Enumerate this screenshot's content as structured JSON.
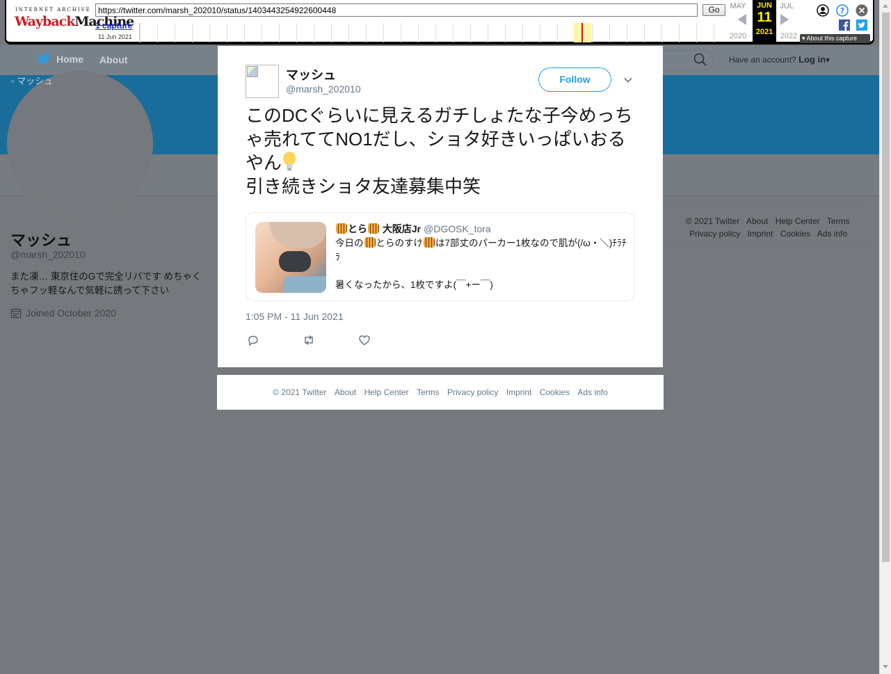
{
  "wayback": {
    "ia_label": "INTERNET ARCHIVE",
    "logo_part1": "Wayback",
    "logo_part2": "Machine",
    "url": "https://twitter.com/marsh_202010/status/1403443254922600448",
    "go_label": "Go",
    "capture_count": "1 capture",
    "capture_date": "11 Jun 2021",
    "prev_month": "MAY",
    "prev_year": "2020",
    "cur_month": "JUN",
    "cur_day": "11",
    "cur_year": "2021",
    "next_month": "JUL",
    "next_year": "2022",
    "about_capture": "▾ About this capture"
  },
  "nav": {
    "home_label": "Home",
    "about_label": "About",
    "login_prefix": "Have an account?",
    "login_label": "Log in"
  },
  "profile": {
    "avatar_alt": "マッシュ",
    "name": "マッシュ",
    "handle": "@marsh_202010",
    "bio": "また凍… 東京住のGで完全リバです めちゃくちゃフッ軽なんで気軽に誘って下さい",
    "joined": "Joined October 2020"
  },
  "side_footer": {
    "row1": [
      "© 2021 Twitter",
      "About",
      "Help Center",
      "Terms"
    ],
    "row2": [
      "Privacy policy",
      "Imprint",
      "Cookies",
      "Ads info"
    ]
  },
  "tweet": {
    "name": "マッシュ",
    "handle": "@marsh_202010",
    "follow_label": "Follow",
    "text_line1": "このDCぐらいに見えるガチしょたな子今めっちゃ売れててNO1だし、ショタ好きいっぱいおるやん",
    "text_line2": "引き続きショタ友達募集中笑",
    "timestamp": "1:05 PM - 11 Jun 2021",
    "quote": {
      "name_a": "とら",
      "name_b": "大阪店Jr",
      "handle": "@DGOSK_tora",
      "body_a": "今日の",
      "body_b": "とらのすけ",
      "body_c": "は7部丈のパーカー1枚なので肌が(/ω・＼)ﾁﾗﾁﾗ",
      "body_d": "暑くなったから、1枚ですよ(￣+ー￣)"
    }
  },
  "footer": {
    "links": [
      "© 2021 Twitter",
      "About",
      "Help Center",
      "Terms",
      "Privacy policy",
      "Imprint",
      "Cookies",
      "Ads info"
    ]
  },
  "colors": {
    "twitter_blue": "#1da1f2",
    "overlay_gray": "#75797d",
    "banner_blue": "#1a6c9a",
    "wayback_red": "#c62027"
  }
}
